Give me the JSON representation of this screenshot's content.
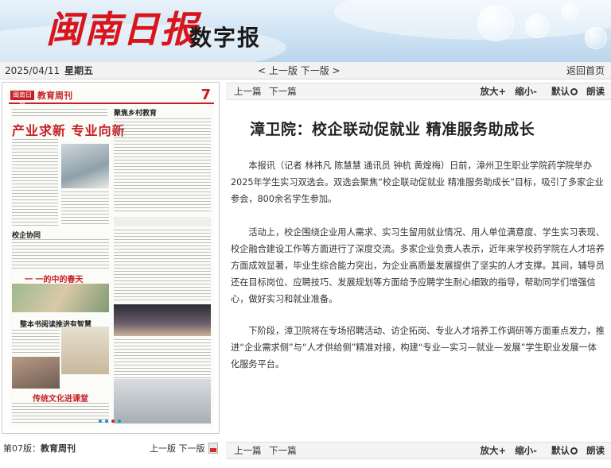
{
  "header": {
    "masthead": "闽南日报",
    "subtitle": "数字报"
  },
  "datebar": {
    "date": "2025/04/11",
    "weekday": "星期五",
    "prev_edition": "< 上一版",
    "next_edition": "下一版 >",
    "home": "返回首页"
  },
  "paper": {
    "logo_text": "闽南日报",
    "section_title": "教育周刊",
    "page_number": "7",
    "headline": "产业求新 专业向新",
    "section_a": "校企协同",
    "section_b": "一 一的中的春天",
    "section_c": "整本书阅读推进有智慧",
    "section_d": "传统文化进课堂",
    "section_e": "聚焦乡村教育"
  },
  "page_caption": {
    "edition": "第07版：",
    "section": "教育周刊",
    "prev": "上一版",
    "next": "下一版"
  },
  "toolbar": {
    "prev": "上一篇",
    "next": "下一篇",
    "font_larger": "放大+",
    "font_smaller": "缩小-",
    "font_default": "默认",
    "read_aloud": "朗读"
  },
  "article": {
    "title": "漳卫院：校企联动促就业 精准服务助成长",
    "paragraphs": [
      "本报讯（记者 林袆凡 陈慧慧 通讯员 钟杭 黄煌梅）日前，漳州卫生职业学院药学院举办2025年学生实习双选会。双选会聚焦“校企联动促就业 精准服务助成长”目标，吸引了多家企业参会，800余名学生参加。",
      "活动上，校企围绕企业用人需求、实习生留用就业情况、用人单位满意度、学生实习表现、校企融合建设工作等方面进行了深度交流。多家企业负责人表示，近年来学校药学院在人才培养方面成效显著，毕业生综合能力突出，为企业高质量发展提供了坚实的人才支撑。其间，辅导员还在目标岗位、应聘技巧、发展规划等方面给予应聘学生耐心细致的指导，帮助同学们增强信心，做好实习和就业准备。",
      "下阶段，漳卫院将在专场招聘活动、访企拓岗、专业人才培养工作调研等方面重点发力，推进“企业需求侧”与“人才供给侧”精准对接，构建“专业—实习—就业—发展”学生职业发展一体化服务平台。"
    ]
  },
  "colors": {
    "masthead_red": "#d8141c",
    "accent_red": "#c62026",
    "banner_blue": "#cfe3f3"
  }
}
